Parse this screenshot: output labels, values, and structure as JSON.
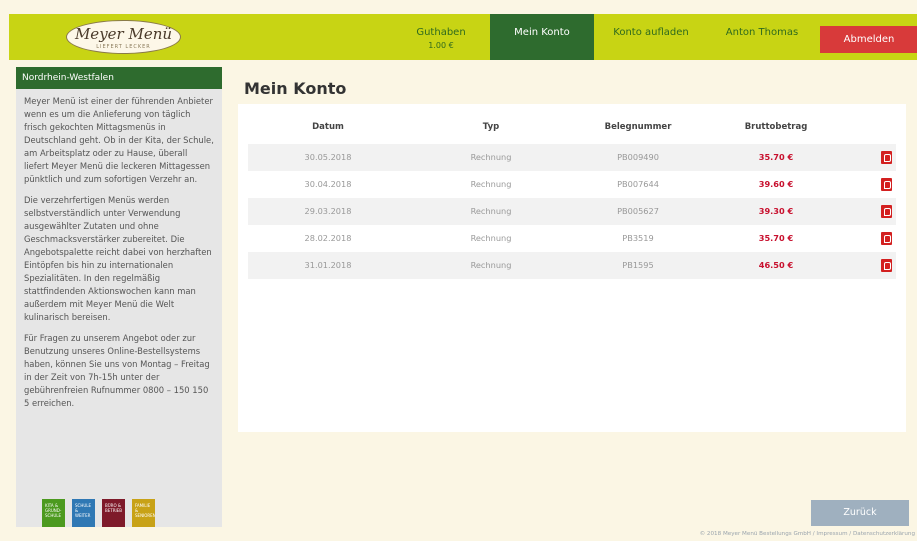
{
  "header": {
    "logo_name": "Meyer Menü",
    "logo_tagline": "LIEFERT LECKER",
    "guthaben_label": "Guthaben",
    "guthaben_amount": "1.00 €",
    "nav_konto": "Mein Konto",
    "nav_aufladen": "Konto aufladen",
    "user_name": "Anton Thomas",
    "logout_label": "Abmelden"
  },
  "sidebar": {
    "title": "Nordrhein-Westfalen",
    "paragraphs": [
      "Meyer Menü ist einer der führenden Anbieter wenn es um die Anlieferung von täglich frisch gekochten Mittagsmenüs in Deutschland geht. Ob in der Kita, der Schule, am Arbeitsplatz oder zu Hause, überall liefert Meyer Menü die leckeren Mittagessen pünktlich und zum sofortigen Verzehr an.",
      "Die verzehrfertigen Menüs werden selbstverständlich unter Verwendung ausgewählter Zutaten und ohne Geschmacksverstärker zubereitet. Die Angebotspalette reicht dabei von herzhaften Eintöpfen bis hin zu internationalen Spezialitäten. In den regelmäßig stattfindenden Aktionswochen kann man außerdem mit Meyer Menü die Welt kulinarisch bereisen.",
      "Für Fragen zu unserem Angebot oder zur Benutzung unseres Online-Bestellsystems haben, können Sie uns von Montag – Freitag in der Zeit von 7h-15h unter der gebührenfreien Rufnummer 0800 – 150 150 5 erreichen."
    ],
    "tiles": [
      "KITA & GRUND-SCHULE",
      "SCHULE & WEITER",
      "BÜRO & BETRIEB",
      "FAMILIE & SENIOREN"
    ]
  },
  "main": {
    "title": "Mein Konto",
    "columns": [
      "Datum",
      "Typ",
      "Belegnummer",
      "Bruttobetrag"
    ],
    "rows": [
      {
        "datum": "30.05.2018",
        "typ": "Rechnung",
        "beleg": "PB009490",
        "betrag": "35.70 €"
      },
      {
        "datum": "30.04.2018",
        "typ": "Rechnung",
        "beleg": "PB007644",
        "betrag": "39.60 €"
      },
      {
        "datum": "29.03.2018",
        "typ": "Rechnung",
        "beleg": "PB005627",
        "betrag": "39.30 €"
      },
      {
        "datum": "28.02.2018",
        "typ": "Rechnung",
        "beleg": "PB3519",
        "betrag": "35.70 €"
      },
      {
        "datum": "31.01.2018",
        "typ": "Rechnung",
        "beleg": "PB1595",
        "betrag": "46.50 €"
      }
    ],
    "back_label": "Zurück"
  },
  "footer": {
    "text": "© 2018 Meyer Menü Bestellungs GmbH / Impressum / Datenschutzerklärung"
  },
  "colors": {
    "header_bg": "#c8d414",
    "brand_green": "#2e6b2e",
    "logout_red": "#d83a3a",
    "amount_red": "#c8102e",
    "back_button": "#9fb0bf"
  },
  "icons": {
    "pdf": "pdf-icon"
  }
}
